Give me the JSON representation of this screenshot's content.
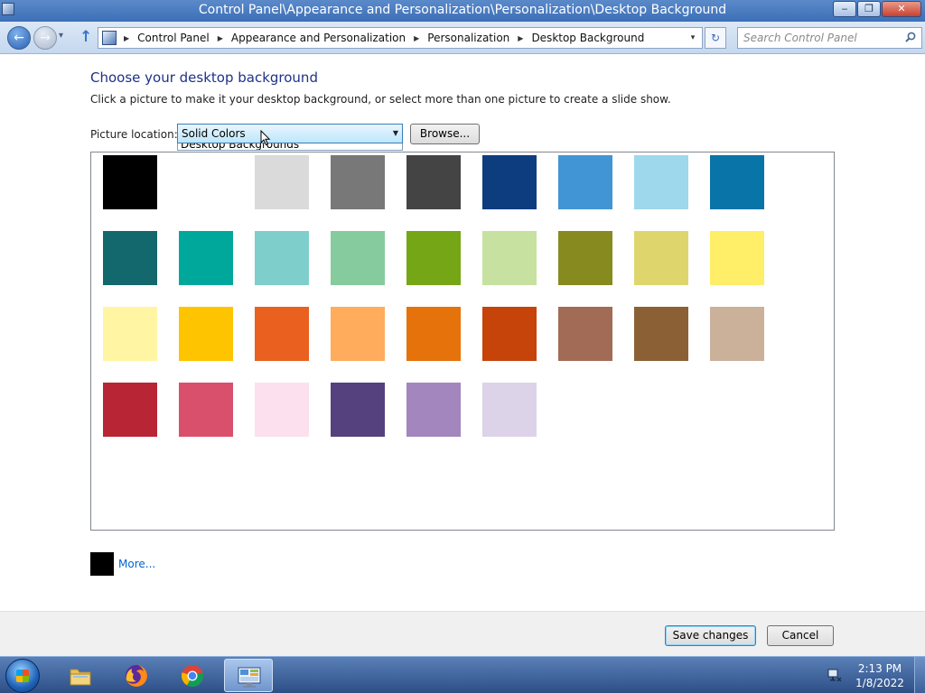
{
  "window": {
    "title": "Control Panel\\Appearance and Personalization\\Personalization\\Desktop Background",
    "minimize": "‒",
    "maximize": "❐",
    "close": "✕"
  },
  "nav": {
    "back_glyph": "←",
    "forward_glyph": "→",
    "dropdown_glyph": "▾",
    "up_glyph": "↑",
    "breadcrumbs": [
      "Control Panel",
      "Appearance and Personalization",
      "Personalization",
      "Desktop Background"
    ],
    "crumb_separator": "▶",
    "address_dropdown_glyph": "▾",
    "refresh_glyph": "↻",
    "search_placeholder": "Search Control Panel",
    "search_value": ""
  },
  "main": {
    "title": "Choose your desktop background",
    "subtitle": "Click a picture to make it your desktop background, or select more than one picture to create a slide show.",
    "location_label": "Picture location:",
    "location_value": "Solid Colors",
    "location_dropdown_arrow": "▼",
    "location_option_peek": "Desktop Backgrounds",
    "browse_label": "Browse...",
    "more_label": "More...",
    "more_color": "#000000"
  },
  "swatches": [
    [
      "#000000",
      "#FFFFFF",
      "#DADADA",
      "#787878",
      "#444444",
      "#0D3D7E",
      "#4295D5",
      "#9ED8EC",
      "#0874A8"
    ],
    [
      "#12686D",
      "#00A89B",
      "#7ECFCC",
      "#86CB9D",
      "#75A616",
      "#C6E1A0",
      "#878A1F",
      "#DED66D",
      "#FFEE68"
    ],
    [
      "#FFF5A3",
      "#FFC400",
      "#EA601F",
      "#FFAC5D",
      "#E5720B",
      "#C6430A",
      "#A26B55",
      "#8B6035",
      "#CBB09A"
    ],
    [
      "#B82534",
      "#D9506C",
      "#FCE0EE",
      "#56417F",
      "#A286BD",
      "#DCD3E8"
    ]
  ],
  "footer": {
    "save_label": "Save changes",
    "cancel_label": "Cancel"
  },
  "taskbar": {
    "items": [
      "start-orb",
      "file-explorer",
      "firefox",
      "chrome",
      "control-panel"
    ],
    "time": "2:13 PM",
    "date": "1/8/2022"
  },
  "colors": {
    "title_text": "#1E3287",
    "link": "#0066CC",
    "taskbar": "#2C4F86"
  }
}
